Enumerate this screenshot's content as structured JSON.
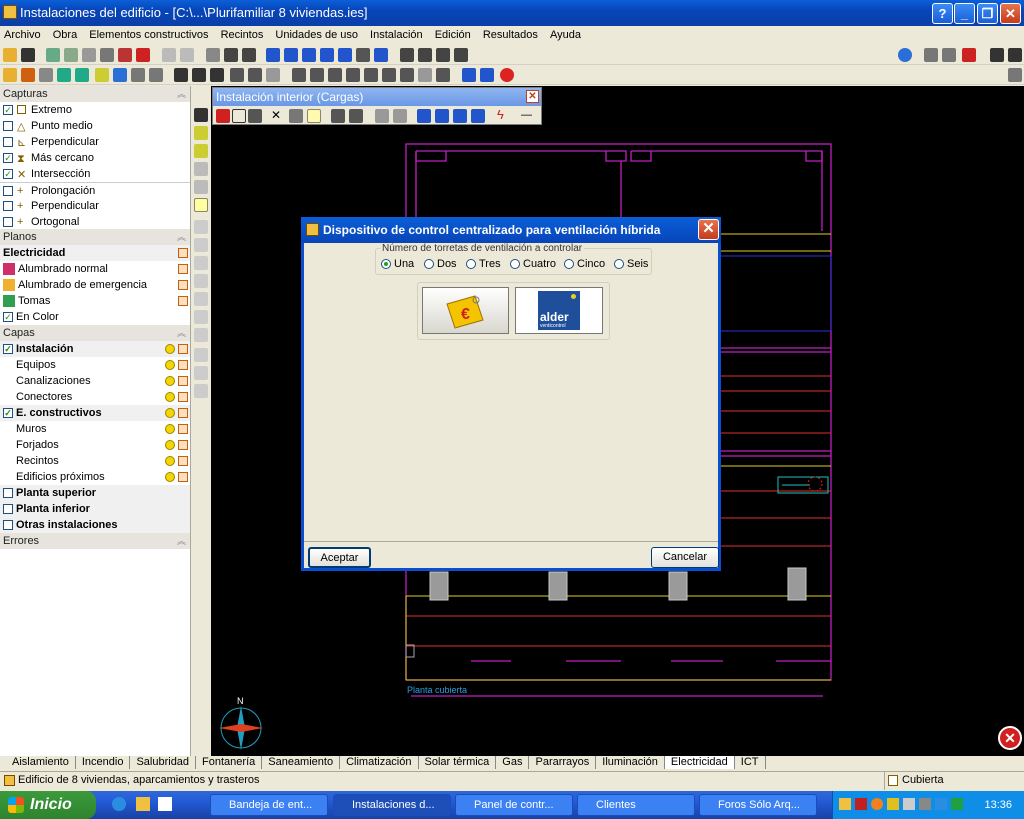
{
  "window": {
    "title": "Instalaciones del edificio - [C:\\...\\Plurifamiliar 8 viviendas.ies]"
  },
  "menu": [
    "Archivo",
    "Obra",
    "Elementos constructivos",
    "Recintos",
    "Unidades de uso",
    "Instalación",
    "Edición",
    "Resultados",
    "Ayuda"
  ],
  "capturas": {
    "header": "Capturas",
    "items": [
      {
        "label": "Extremo",
        "checked": true
      },
      {
        "label": "Punto medio",
        "checked": false
      },
      {
        "label": "Perpendicular",
        "checked": false
      },
      {
        "label": "Más cercano",
        "checked": true
      },
      {
        "label": "Intersección",
        "checked": true
      },
      {
        "label": "Prolongación",
        "checked": false
      },
      {
        "label": "Perpendicular",
        "checked": false
      },
      {
        "label": "Ortogonal",
        "checked": false
      }
    ]
  },
  "planos": {
    "header": "Planos",
    "group": "Electricidad",
    "items": [
      "Alumbrado normal",
      "Alumbrado de emergencia",
      "Tomas"
    ],
    "encolor": "En Color"
  },
  "capas": {
    "header": "Capas",
    "instalacion": "Instalación",
    "inst_items": [
      "Equipos",
      "Canalizaciones",
      "Conectores"
    ],
    "constructivos": "E. constructivos",
    "cons_items": [
      "Muros",
      "Forjados",
      "Recintos",
      "Edificios próximos"
    ],
    "others": [
      "Planta superior",
      "Planta inferior",
      "Otras instalaciones"
    ]
  },
  "errores": "Errores",
  "floatbar": {
    "title": "Instalación interior (Cargas)"
  },
  "dialog": {
    "title": "Dispositivo de control centralizado para ventilación híbrida",
    "legend": "Número de torretas de ventilación a controlar",
    "options": [
      "Una",
      "Dos",
      "Tres",
      "Cuatro",
      "Cinco",
      "Seis"
    ],
    "selected": "Una",
    "brand_main": "alder",
    "brand_sub": "venticontrol",
    "accept": "Aceptar",
    "cancel": "Cancelar"
  },
  "canvas": {
    "plan_label": "Planta cubierta",
    "north": "N"
  },
  "tabs": [
    "Aislamiento",
    "Incendio",
    "Salubridad",
    "Fontanería",
    "Saneamiento",
    "Climatización",
    "Solar térmica",
    "Gas",
    "Pararrayos",
    "Iluminación",
    "Electricidad",
    "ICT"
  ],
  "active_tab": "Electricidad",
  "status": {
    "left": "Edificio de 8 viviendas, aparcamientos y trasteros",
    "right": "Cubierta"
  },
  "taskbar": {
    "start": "Inicio",
    "tasks": [
      "Bandeja de ent...",
      "Instalaciones d...",
      "Panel de contr...",
      "Clientes",
      "Foros Sólo Arq..."
    ],
    "time": "13:36"
  }
}
